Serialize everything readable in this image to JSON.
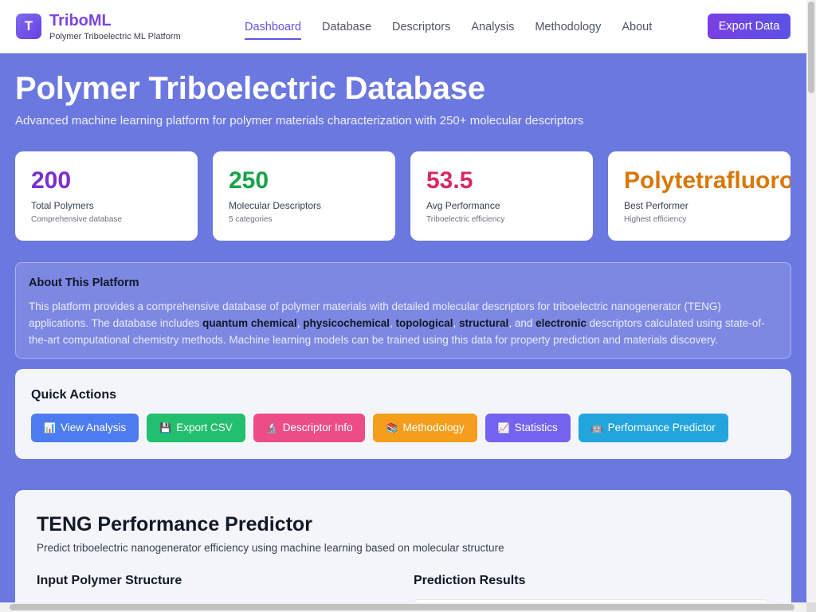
{
  "brand": {
    "logo_letter": "T",
    "name": "TriboML",
    "subtitle": "Polymer Triboelectric ML Platform"
  },
  "nav": [
    {
      "label": "Dashboard",
      "active": true
    },
    {
      "label": "Database"
    },
    {
      "label": "Descriptors"
    },
    {
      "label": "Analysis"
    },
    {
      "label": "Methodology"
    },
    {
      "label": "About"
    }
  ],
  "header": {
    "export_label": "Export Data"
  },
  "hero": {
    "title": "Polymer Triboelectric Database",
    "subtitle": "Advanced machine learning platform for polymer materials characterization with 250+ molecular descriptors"
  },
  "stats": [
    {
      "value": "200",
      "label": "Total Polymers",
      "desc": "Comprehensive database",
      "color": "#7b2fd0"
    },
    {
      "value": "250",
      "label": "Molecular Descriptors",
      "desc": "5 categories",
      "color": "#16a34a"
    },
    {
      "value": "53.5",
      "label": "Avg Performance",
      "desc": "Triboelectric efficiency",
      "color": "#db2766"
    },
    {
      "value": "Polytetrafluoroethylene",
      "label": "Best Performer",
      "desc": "Highest efficiency",
      "color": "#d97706"
    }
  ],
  "about": {
    "title": "About This Platform",
    "text_1": "This platform provides a comprehensive database of polymer materials with detailed molecular descriptors for triboelectric nanogenerator (TENG) applications. The database includes ",
    "kw_1": "quantum chemical",
    "sep_1": ", ",
    "kw_2": "physicochemical",
    "sep_2": ", ",
    "kw_3": "topological",
    "sep_3": ", ",
    "kw_4": "structural",
    "sep_4": ", and ",
    "kw_5": "electronic",
    "text_2": " descriptors calculated using state-of-the-art computational chemistry methods. Machine learning models can be trained using this data for property prediction and materials discovery."
  },
  "quick_actions": {
    "title": "Quick Actions",
    "buttons": [
      {
        "icon": "📊",
        "label": "View Analysis",
        "color": "#4d7cf0"
      },
      {
        "icon": "💾",
        "label": "Export CSV",
        "color": "#22bf6e"
      },
      {
        "icon": "🔬",
        "label": "Descriptor Info",
        "color": "#ec4d86"
      },
      {
        "icon": "📚",
        "label": "Methodology",
        "color": "#f59e1b"
      },
      {
        "icon": "📈",
        "label": "Statistics",
        "color": "#7363ee"
      },
      {
        "icon": "🤖",
        "label": "Performance Predictor",
        "color": "#22a4dc"
      }
    ]
  },
  "predictor": {
    "title": "TENG Performance Predictor",
    "subtitle": "Predict triboelectric nanogenerator efficiency using machine learning based on molecular structure",
    "input_title": "Input Polymer Structure",
    "results_title": "Prediction Results"
  }
}
